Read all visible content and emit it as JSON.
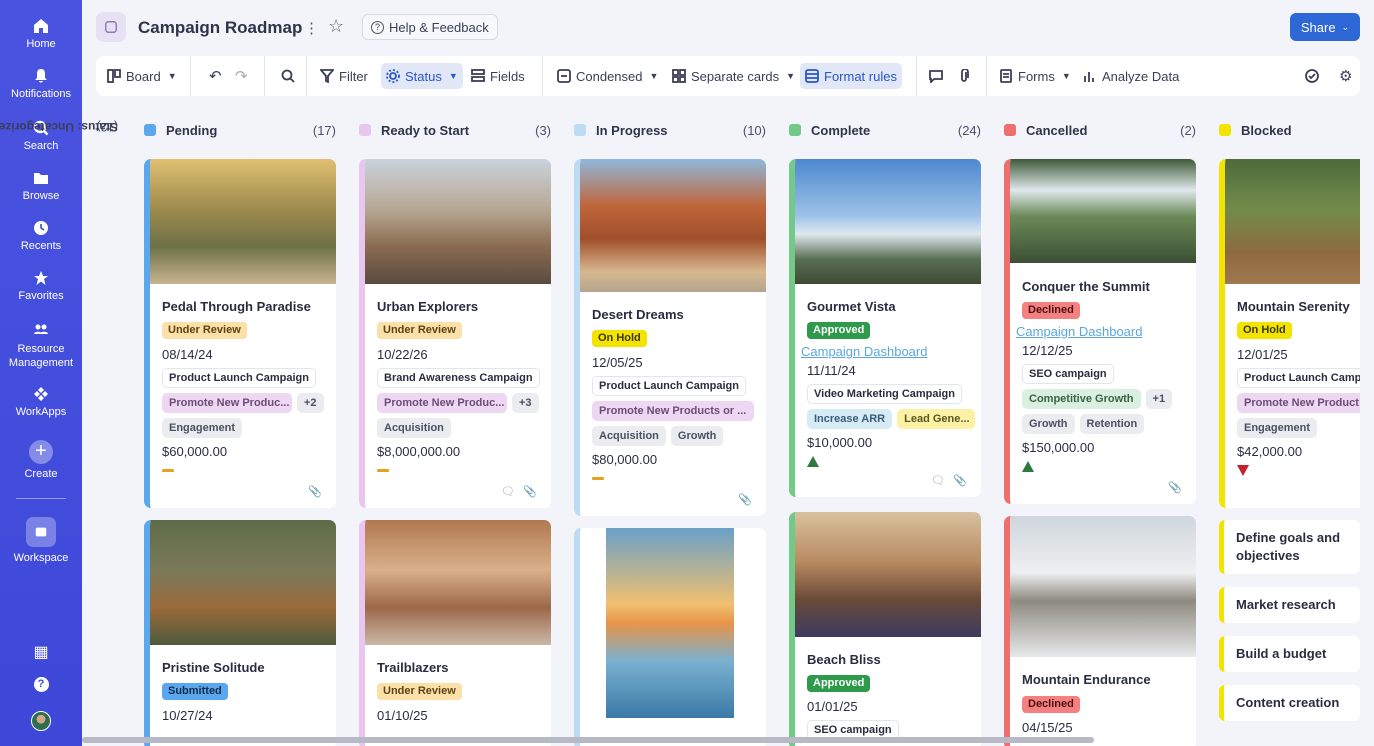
{
  "rail": [
    {
      "label": "Home",
      "icon": "home-icon"
    },
    {
      "label": "Notifications",
      "icon": "bell-icon"
    },
    {
      "label": "Search",
      "icon": "search-icon"
    },
    {
      "label": "Browse",
      "icon": "folder-icon"
    },
    {
      "label": "Recents",
      "icon": "clock-icon"
    },
    {
      "label": "Favorites",
      "icon": "star-icon"
    },
    {
      "label": "Resource Management",
      "icon": "people-icon"
    },
    {
      "label": "WorkApps",
      "icon": "workapps-icon"
    },
    {
      "label": "Create",
      "icon": "plus-icon"
    },
    {
      "label": "Workspace",
      "icon": "workspace-icon"
    }
  ],
  "header": {
    "title": "Campaign Roadmap",
    "help": "Help & Feedback",
    "share": "Share"
  },
  "toolbar": {
    "board": "Board",
    "filter": "Filter",
    "status": "Status",
    "fields": "Fields",
    "condensed": "Condensed",
    "separate": "Separate cards",
    "format": "Format rules",
    "forms": "Forms",
    "analyze": "Analyze Data"
  },
  "board": {
    "uncategorized": "Status: Uncategorized",
    "uncategorized_count": "(12)",
    "columns": [
      {
        "name": "Pending",
        "count": "(17)",
        "color": "#5aa7ee"
      },
      {
        "name": "Ready to Start",
        "count": "(3)",
        "color": "#e8c6f0"
      },
      {
        "name": "In Progress",
        "count": "(10)",
        "color": "#bcdcf3"
      },
      {
        "name": "Complete",
        "count": "(24)",
        "color": "#73c987"
      },
      {
        "name": "Cancelled",
        "count": "(2)",
        "color": "#ef6e6e"
      },
      {
        "name": "Blocked",
        "count": "",
        "color": "#f2e400"
      }
    ]
  },
  "cards": {
    "c1": {
      "title": "Pedal Through Paradise",
      "status": "Under Review",
      "date": "08/14/24",
      "chip1": "Product Launch Campaign",
      "chip2": "Promote New Produc...",
      "more": "+2",
      "chip3": "Engagement",
      "amount": "$60,000.00"
    },
    "c2": {
      "title": "Urban Explorers",
      "status": "Under Review",
      "date": "10/22/26",
      "chip1": "Brand Awareness Campaign",
      "chip2": "Promote New Produc...",
      "more": "+3",
      "chip3": "Acquisition",
      "amount": "$8,000,000.00"
    },
    "c3": {
      "title": "Desert Dreams",
      "status": "On Hold",
      "date": "12/05/25",
      "chip1": "Product Launch Campaign",
      "chip2": "Promote New Products or ...",
      "chip3": "Acquisition",
      "chip4": "Growth",
      "amount": "$80,000.00"
    },
    "c4": {
      "title": "Gourmet Vista",
      "status": "Approved",
      "link": "Campaign Dashboard",
      "date": "11/11/24",
      "chip1": "Video Marketing Campaign",
      "chip2": "Increase ARR",
      "chip3": "Lead Gene...",
      "amount": "$10,000.00"
    },
    "c5": {
      "title": "Conquer the Summit",
      "status": "Declined",
      "link": "Campaign Dashboard",
      "date": "12/12/25",
      "chip1": "SEO campaign",
      "chip2": "Competitive Growth",
      "more": "+1",
      "chip3": "Growth",
      "chip4": "Retention",
      "amount": "$150,000.00"
    },
    "c6": {
      "title": "Mountain Serenity",
      "status": "On Hold",
      "date": "12/01/25",
      "chip1": "Product Launch Camp",
      "chip2": "Promote New Product",
      "chip3": "Engagement",
      "amount": "$42,000.00"
    },
    "c7": {
      "title": "Pristine Solitude",
      "status": "Submitted",
      "date": "10/27/24"
    },
    "c8": {
      "title": "Trailblazers",
      "status": "Under Review",
      "date": "01/10/25"
    },
    "c9": {
      "title": "Beach Bliss",
      "status": "Approved",
      "date": "01/01/25",
      "chip1": "SEO campaign"
    },
    "c10": {
      "title": "Mountain Endurance",
      "status": "Declined",
      "date": "04/15/25"
    }
  },
  "blocked_tasks": [
    "Define goals and objectives",
    "Market research",
    "Build a budget",
    "Content creation"
  ]
}
